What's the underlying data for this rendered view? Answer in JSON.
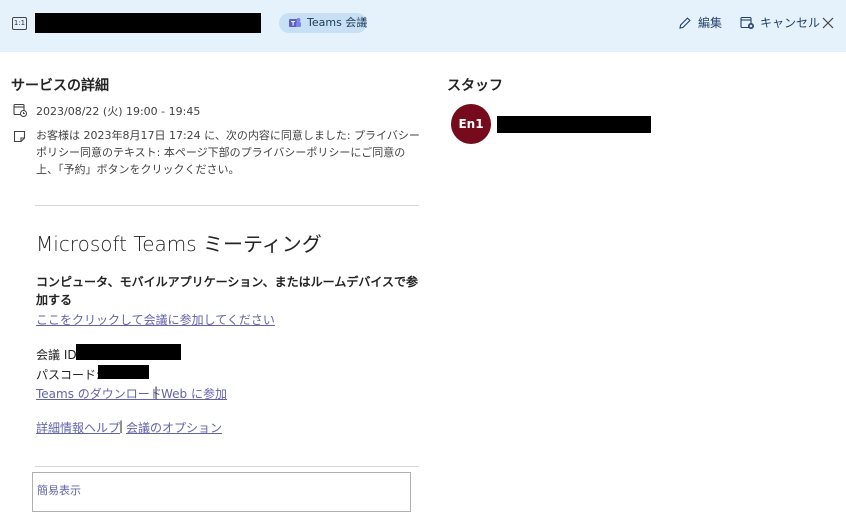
{
  "header": {
    "app_icon_text": "1:1",
    "badge_label": "Teams 会議",
    "edit_label": "編集",
    "cancel_label": "キャンセル"
  },
  "service": {
    "title": "サービスの詳細",
    "datetime": "2023/08/22 (火) 19:00 - 19:45",
    "consent_note": "お客様は 2023年8月17日 17:24 に、次の内容に同意しました: プライバシー ポリシー同意のテキスト: 本ページ下部のプライバシーポリシーにご同意の上、「予約」ボタンをクリックください。"
  },
  "meeting": {
    "title": "Microsoft Teams ミーティング",
    "join_heading": "コンピュータ、モバイルアプリケーション、またはルームデバイスで参加する",
    "join_link": "ここをクリックして会議に参加してください",
    "meeting_id_label": "会議 ID:",
    "passcode_label": "パスコード:",
    "download_link": "Teams のダウンロード",
    "web_join_link": "Web に参加",
    "separator": "|",
    "help_link": "詳細情報ヘルプ",
    "options_link": "会議のオプション",
    "simple_view_link": "簡易表示"
  },
  "staff": {
    "title": "スタッフ",
    "avatar_initials": "En1"
  },
  "colors": {
    "header_bg": "#e5f2fb",
    "badge_bg": "#c7e0f4",
    "link": "#6264a7",
    "avatar_bg": "#750b1c"
  }
}
